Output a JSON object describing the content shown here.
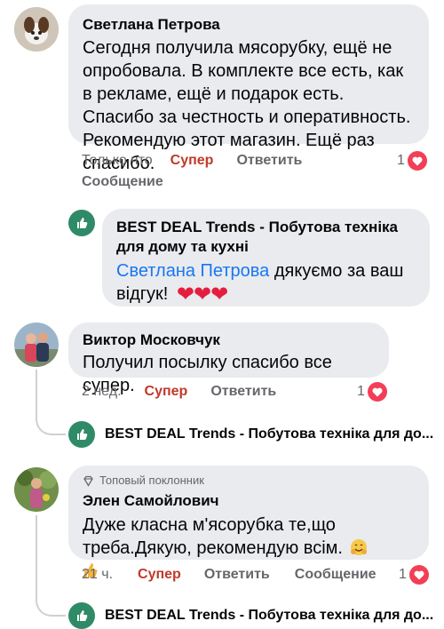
{
  "comments": [
    {
      "author": "Светлана Петрова",
      "text": "Сегодня получила мясорубку, ещё не опробовала. В комплекте все есть, как в рекламе, ещё и подарок есть. Спасибо за честность и оперативность. Рекомендую этот магазин. Ещё раз спасибо.",
      "time": "Только что",
      "like_label": "Супер",
      "reply_label": "Ответить",
      "message_label": "Сообщение",
      "reaction_count": "1"
    },
    {
      "author": "Виктор Московчук",
      "text": "Получил посылку спасибо все супер.",
      "time": "2 нед.",
      "like_label": "Супер",
      "reply_label": "Ответить",
      "reaction_count": "1"
    },
    {
      "badge": "Топовый поклонник",
      "author": "Элен Самойлович",
      "text": "Дуже класна м'ясорубка те,що треба.Дякую, рекомендую всім.",
      "time": "21 ч.",
      "like_label": "Супер",
      "reply_label": "Ответить",
      "message_label": "Сообщение",
      "reaction_count": "1"
    }
  ],
  "page_reply": {
    "author": "BEST DEAL Trends - Побутова техніка для дому та кухні",
    "mention": "Светлана Петрова",
    "text": "дякуємо за ваш відгук!"
  },
  "collapsed_replies": [
    {
      "author": "BEST DEAL Trends - Побутова техніка для до..."
    },
    {
      "author": "BEST DEAL Trends - Побутова техніка для до..."
    }
  ],
  "colors": {
    "bubble": "#e9ebee",
    "super": "#c0392b",
    "link": "#1877f2",
    "heart": "#f33e58",
    "brand": "#2f8b67"
  },
  "icons": [
    "heart-icon",
    "brand-logo-icon",
    "diamond-badge-icon",
    "hugging-face-emoji",
    "thumbs-up-emoji"
  ]
}
